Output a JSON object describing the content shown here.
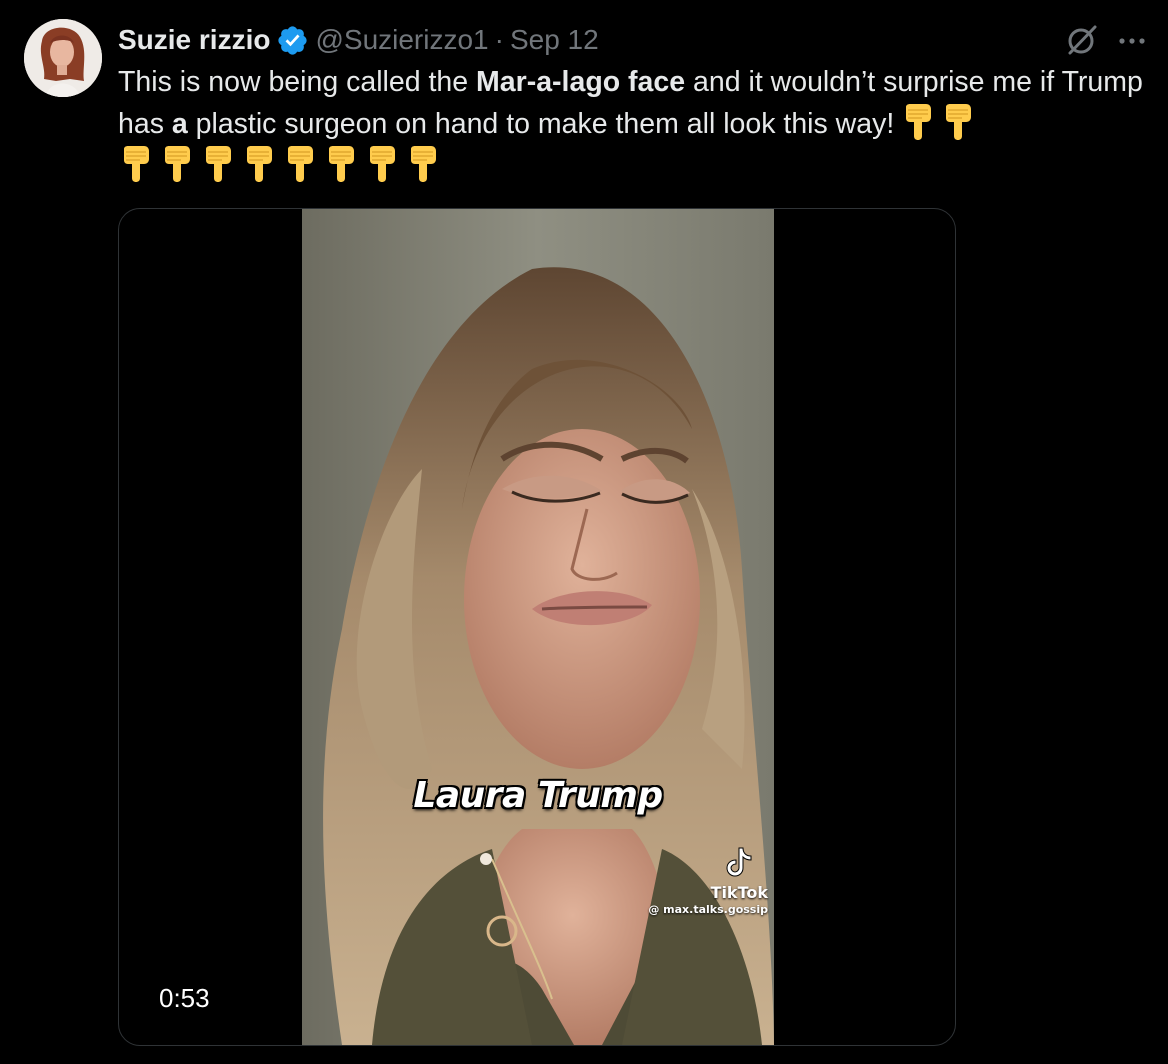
{
  "tweet": {
    "author": {
      "display_name": "Suzie rizzio",
      "handle": "@Suzierizzo1",
      "verified": true,
      "avatar_icon": "profile-photo"
    },
    "separator": "·",
    "date": "Sep 12",
    "text_parts": {
      "p1": "This is now being called the ",
      "bold1": "Mar-a-lago face",
      "p2": " and it wouldn’t surprise me if Trump has ",
      "bold2": "a",
      "p3": " plastic surgeon on hand to make them all look this way!"
    },
    "emoji": {
      "name": "backhand-index-pointing-down",
      "glyph": "👇",
      "count_first_line": 2,
      "count_second_line": 8
    },
    "media": {
      "type": "video",
      "duration": "0:53",
      "caption": "Laura Trump",
      "watermark_brand": "TikTok",
      "watermark_user": "@ max.talks.gossip"
    }
  },
  "colors": {
    "background": "#000000",
    "text_primary": "#e7e9ea",
    "text_secondary": "#71767b",
    "verified_blue": "#1d9bf0",
    "border": "#2f3336",
    "emoji_yellow": "#ffcc4d"
  }
}
